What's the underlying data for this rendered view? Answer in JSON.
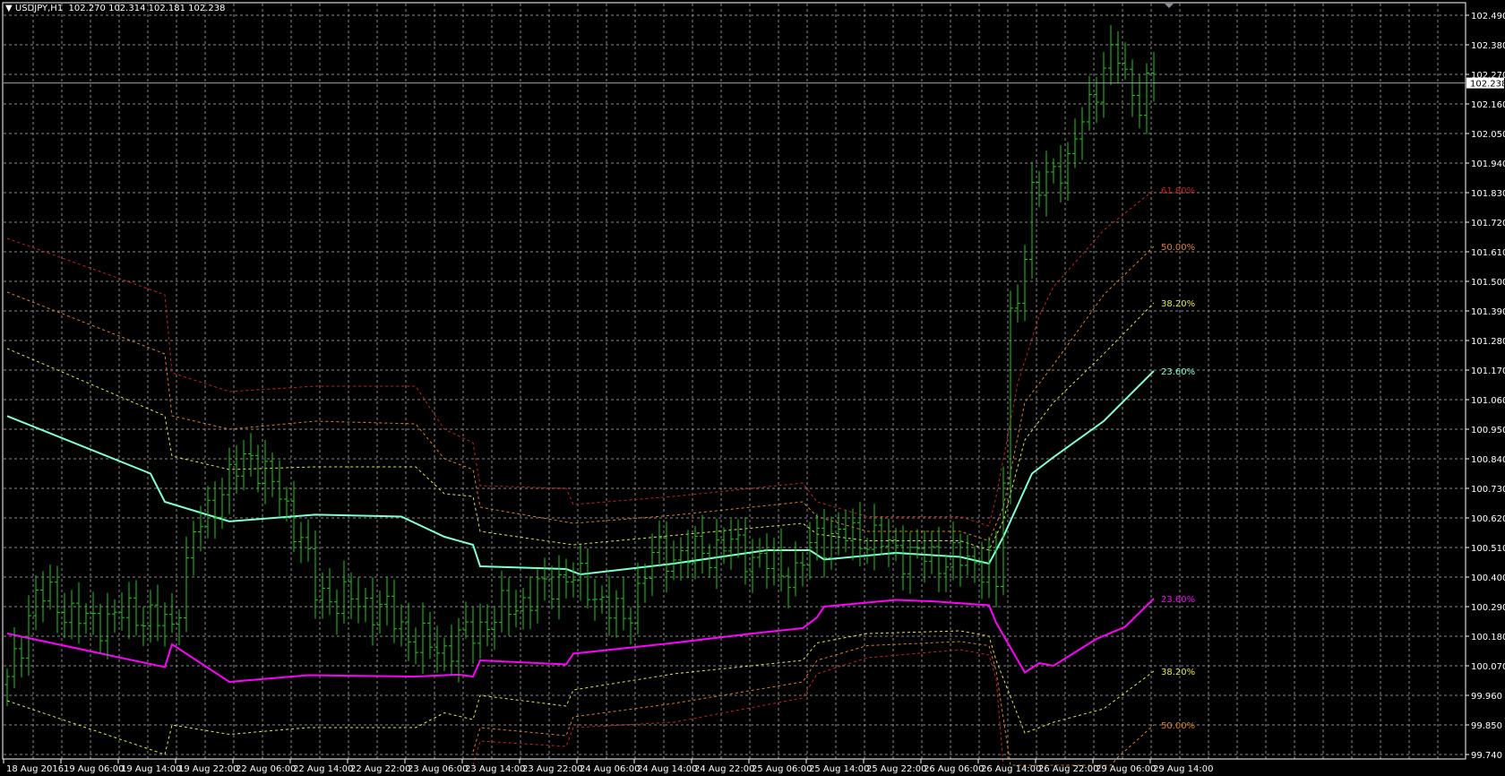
{
  "header": {
    "arrow": "▼",
    "symbol": "USDJPY,H1",
    "ohlc": "102.270 102.314 102.181 102.238"
  },
  "colors": {
    "background": "#000000",
    "grid": "#8a8a8a",
    "axis": "#ffffff",
    "bars": "#1ec81e",
    "cyan": "#7fffd4",
    "magenta": "#ff00ff",
    "red": "#cc2020",
    "orange": "#e0802a",
    "yellow": "#e8e840"
  },
  "chart_data": {
    "type": "ohlc-bar",
    "title": "USDJPY,H1",
    "current_price": "102.238",
    "ylim": [
      99.74,
      102.49
    ],
    "y_ticks": [
      "102.490",
      "102.380",
      "102.270",
      "102.160",
      "102.050",
      "101.940",
      "101.830",
      "101.720",
      "101.610",
      "101.500",
      "101.390",
      "101.280",
      "101.170",
      "101.060",
      "100.950",
      "100.840",
      "100.730",
      "100.620",
      "100.510",
      "100.400",
      "100.290",
      "100.180",
      "100.070",
      "99.960",
      "99.850",
      "99.740"
    ],
    "x_ticks": [
      "18 Aug 2016",
      "19 Aug 06:00",
      "19 Aug 14:00",
      "19 Aug 22:00",
      "22 Aug 06:00",
      "22 Aug 14:00",
      "22 Aug 22:00",
      "23 Aug 06:00",
      "23 Aug 14:00",
      "23 Aug 22:00",
      "24 Aug 06:00",
      "24 Aug 14:00",
      "24 Aug 22:00",
      "25 Aug 06:00",
      "25 Aug 14:00",
      "25 Aug 22:00",
      "26 Aug 06:00",
      "26 Aug 14:00",
      "26 Aug 22:00",
      "29 Aug 06:00",
      "29 Aug 14:00"
    ],
    "bar_count": 161,
    "close_path": [
      [
        0,
        100.0
      ],
      [
        4,
        100.34
      ],
      [
        7,
        100.3
      ],
      [
        11,
        100.23
      ],
      [
        18,
        100.27
      ],
      [
        23,
        100.215
      ],
      [
        26,
        100.55
      ],
      [
        30,
        100.73
      ],
      [
        34,
        100.86
      ],
      [
        38,
        100.7
      ],
      [
        41,
        100.55
      ],
      [
        43,
        100.34
      ],
      [
        50,
        100.3
      ],
      [
        53,
        100.27
      ],
      [
        57,
        100.16
      ],
      [
        61,
        100.13
      ],
      [
        65,
        100.2
      ],
      [
        69,
        100.27
      ],
      [
        74,
        100.34
      ],
      [
        78,
        100.41
      ],
      [
        82,
        100.34
      ],
      [
        86,
        100.23
      ],
      [
        90,
        100.48
      ],
      [
        95,
        100.48
      ],
      [
        101,
        100.52
      ],
      [
        106,
        100.45
      ],
      [
        110,
        100.41
      ],
      [
        113,
        100.55
      ],
      [
        120,
        100.55
      ],
      [
        126,
        100.48
      ],
      [
        137,
        100.45
      ],
      [
        138,
        100.34
      ],
      [
        139,
        100.77
      ],
      [
        140,
        101.37
      ],
      [
        142,
        101.59
      ],
      [
        143,
        101.8
      ],
      [
        146,
        101.94
      ],
      [
        148,
        101.91
      ],
      [
        150,
        102.12
      ],
      [
        153,
        102.28
      ],
      [
        155,
        102.35
      ],
      [
        157,
        102.21
      ],
      [
        158,
        102.16
      ],
      [
        160,
        102.238
      ]
    ],
    "series": [
      {
        "name": "upper-61.8",
        "label": "61.80%",
        "color": "red",
        "style": "dotted",
        "points": [
          [
            0,
            101.66
          ],
          [
            22,
            101.45
          ],
          [
            23,
            101.16
          ],
          [
            31,
            101.09
          ],
          [
            43,
            101.11
          ],
          [
            57,
            101.11
          ],
          [
            61,
            100.95
          ],
          [
            65,
            100.9
          ],
          [
            66,
            100.74
          ],
          [
            78,
            100.73
          ],
          [
            79,
            100.67
          ],
          [
            93,
            100.7
          ],
          [
            111,
            100.75
          ],
          [
            113,
            100.68
          ],
          [
            120,
            100.625
          ],
          [
            133,
            100.625
          ],
          [
            137,
            100.59
          ],
          [
            138,
            100.7
          ],
          [
            141,
            101.12
          ],
          [
            144,
            101.37
          ],
          [
            146,
            101.48
          ],
          [
            153,
            101.69
          ],
          [
            160,
            101.84
          ]
        ]
      },
      {
        "name": "upper-50",
        "label": "50.00%",
        "color": "orange",
        "style": "dotted",
        "points": [
          [
            0,
            101.46
          ],
          [
            22,
            101.23
          ],
          [
            23,
            101.0
          ],
          [
            31,
            100.95
          ],
          [
            43,
            100.98
          ],
          [
            57,
            100.97
          ],
          [
            61,
            100.84
          ],
          [
            65,
            100.8
          ],
          [
            66,
            100.66
          ],
          [
            79,
            100.6
          ],
          [
            93,
            100.63
          ],
          [
            111,
            100.68
          ],
          [
            113,
            100.625
          ],
          [
            120,
            100.57
          ],
          [
            133,
            100.57
          ],
          [
            137,
            100.535
          ],
          [
            139,
            100.66
          ],
          [
            142,
            101.05
          ],
          [
            146,
            101.19
          ],
          [
            153,
            101.45
          ],
          [
            160,
            101.63
          ]
        ]
      },
      {
        "name": "upper-38.2",
        "label": "38.20%",
        "color": "yellow",
        "style": "dotted",
        "points": [
          [
            0,
            101.25
          ],
          [
            22,
            101.0
          ],
          [
            23,
            100.85
          ],
          [
            31,
            100.8
          ],
          [
            43,
            100.81
          ],
          [
            57,
            100.81
          ],
          [
            61,
            100.71
          ],
          [
            65,
            100.7
          ],
          [
            66,
            100.57
          ],
          [
            79,
            100.52
          ],
          [
            93,
            100.555
          ],
          [
            111,
            100.6
          ],
          [
            113,
            100.56
          ],
          [
            120,
            100.535
          ],
          [
            133,
            100.535
          ],
          [
            137,
            100.5
          ],
          [
            139,
            100.61
          ],
          [
            142,
            100.91
          ],
          [
            146,
            101.05
          ],
          [
            153,
            101.23
          ],
          [
            160,
            101.42
          ]
        ]
      },
      {
        "name": "upper-23.6",
        "label": "23.60%",
        "color": "cyan",
        "style": "solid",
        "points": [
          [
            0,
            100.999
          ],
          [
            20,
            100.785
          ],
          [
            22,
            100.68
          ],
          [
            31,
            100.607
          ],
          [
            43,
            100.632
          ],
          [
            55,
            100.625
          ],
          [
            61,
            100.55
          ],
          [
            65,
            100.52
          ],
          [
            66,
            100.44
          ],
          [
            78,
            100.43
          ],
          [
            80,
            100.41
          ],
          [
            93,
            100.45
          ],
          [
            106,
            100.5
          ],
          [
            112,
            100.5
          ],
          [
            114,
            100.465
          ],
          [
            124,
            100.49
          ],
          [
            133,
            100.475
          ],
          [
            137,
            100.45
          ],
          [
            139,
            100.55
          ],
          [
            143,
            100.785
          ],
          [
            146,
            100.846
          ],
          [
            153,
            100.98
          ],
          [
            160,
            101.167
          ]
        ]
      },
      {
        "name": "lower-23.6",
        "label": "23.60%",
        "color": "magenta",
        "style": "solid",
        "points": [
          [
            0,
            100.19
          ],
          [
            22,
            100.065
          ],
          [
            23,
            100.15
          ],
          [
            31,
            100.01
          ],
          [
            42,
            100.035
          ],
          [
            57,
            100.03
          ],
          [
            63,
            100.037
          ],
          [
            65,
            100.03
          ],
          [
            66,
            100.09
          ],
          [
            78,
            100.075
          ],
          [
            79,
            100.115
          ],
          [
            93,
            100.155
          ],
          [
            104,
            100.19
          ],
          [
            111,
            100.21
          ],
          [
            113,
            100.25
          ],
          [
            114,
            100.29
          ],
          [
            124,
            100.315
          ],
          [
            129,
            100.31
          ],
          [
            137,
            100.295
          ],
          [
            138,
            100.23
          ],
          [
            142,
            100.045
          ],
          [
            144,
            100.08
          ],
          [
            146,
            100.07
          ],
          [
            152,
            100.17
          ],
          [
            156,
            100.215
          ],
          [
            160,
            100.32
          ]
        ]
      },
      {
        "name": "lower-38.2",
        "label": "38.20%",
        "color": "yellow",
        "style": "dotted",
        "points": [
          [
            0,
            99.94
          ],
          [
            22,
            99.74
          ],
          [
            23,
            99.85
          ],
          [
            31,
            99.815
          ],
          [
            42,
            99.84
          ],
          [
            57,
            99.84
          ],
          [
            61,
            99.895
          ],
          [
            65,
            99.87
          ],
          [
            66,
            99.96
          ],
          [
            78,
            99.92
          ],
          [
            79,
            99.98
          ],
          [
            93,
            100.04
          ],
          [
            111,
            100.09
          ],
          [
            113,
            100.155
          ],
          [
            120,
            100.19
          ],
          [
            133,
            100.2
          ],
          [
            137,
            100.18
          ],
          [
            138,
            100.09
          ],
          [
            142,
            99.82
          ],
          [
            146,
            99.86
          ],
          [
            153,
            99.91
          ],
          [
            160,
            100.05
          ]
        ]
      },
      {
        "name": "lower-50",
        "label": "50.00%",
        "color": "orange",
        "style": "dotted",
        "points": [
          [
            65,
            99.75
          ],
          [
            66,
            99.84
          ],
          [
            78,
            99.81
          ],
          [
            79,
            99.88
          ],
          [
            93,
            99.93
          ],
          [
            111,
            100.01
          ],
          [
            113,
            100.09
          ],
          [
            120,
            100.145
          ],
          [
            133,
            100.16
          ],
          [
            137,
            100.145
          ],
          [
            138,
            100.05
          ],
          [
            140,
            99.7
          ],
          [
            154,
            99.7
          ],
          [
            155,
            99.73
          ],
          [
            160,
            99.85
          ]
        ]
      },
      {
        "name": "lower-61.8",
        "label": "",
        "color": "red",
        "style": "dotted",
        "points": [
          [
            65,
            99.7
          ],
          [
            66,
            99.79
          ],
          [
            78,
            99.77
          ],
          [
            79,
            99.84
          ],
          [
            93,
            99.86
          ],
          [
            111,
            99.95
          ],
          [
            113,
            100.04
          ],
          [
            120,
            100.1
          ],
          [
            133,
            100.13
          ],
          [
            137,
            100.11
          ],
          [
            138,
            100.02
          ],
          [
            139,
            99.7
          ]
        ]
      }
    ]
  }
}
